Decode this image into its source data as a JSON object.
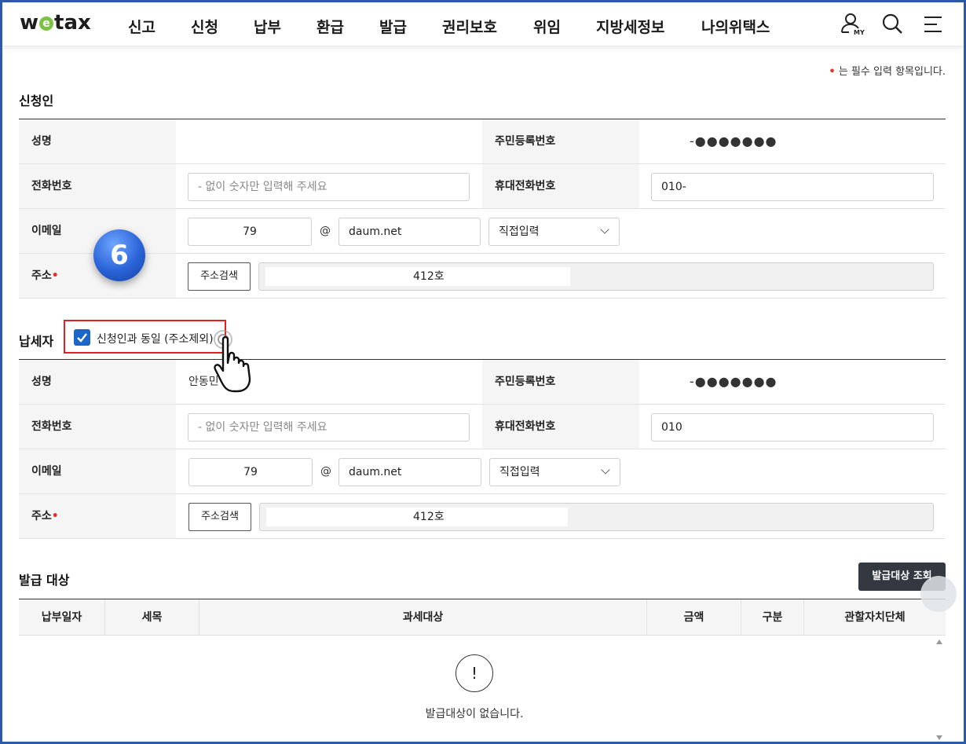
{
  "header": {
    "logo_pre": "w",
    "logo_e": "e",
    "logo_post": "tax",
    "nav": [
      "신고",
      "신청",
      "납부",
      "환급",
      "발급",
      "권리보호",
      "위임",
      "지방세정보",
      "나의위택스"
    ],
    "my_label": "MY",
    "icons": [
      "user-icon",
      "search-icon",
      "menu-icon"
    ]
  },
  "required_note": {
    "dot": "•",
    "text": " 는 필수 입력 항목입니다."
  },
  "applicant": {
    "title": "신청인",
    "name_label": "성명",
    "name_value": "",
    "rrn_label": "주민등록번호",
    "rrn_value": "-●●●●●●●",
    "phone_label": "전화번호",
    "phone_placeholder": "- 없이 숫자만 입력해 주세요",
    "mobile_label": "휴대전화번호",
    "mobile_value": "010-",
    "email_label": "이메일",
    "email_id": "79",
    "at": "@",
    "email_domain": "daum.net",
    "email_select": "직접입력",
    "address_label": "주소",
    "address_required": "•",
    "address_button": "주소검색",
    "address_value": "412호"
  },
  "step_badge": "6",
  "taxpayer": {
    "title": "납세자",
    "same_checkbox_label": "신청인과 동일 (주소제외)",
    "same_checked": true,
    "name_label": "성명",
    "name_value": "안동민",
    "rrn_label": "주민등록번호",
    "rrn_value": "-●●●●●●●",
    "phone_label": "전화번호",
    "phone_placeholder": "- 없이 숫자만 입력해 주세요",
    "mobile_label": "휴대전화번호",
    "mobile_value": "010",
    "email_label": "이메일",
    "email_id": "79",
    "at": "@",
    "email_domain": "daum.net",
    "email_select": "직접입력",
    "address_label": "주소",
    "address_required": "•",
    "address_button": "주소검색",
    "address_value": "412호"
  },
  "issue_target": {
    "title": "발급 대상",
    "query_button": "발급대상 조회",
    "columns": [
      "납부일자",
      "세목",
      "과세대상",
      "금액",
      "구분",
      "관할자치단체"
    ],
    "empty_icon": "!",
    "empty_text": "발급대상이 없습니다."
  },
  "colors": {
    "accent_blue": "#1b66c9",
    "required_red": "#e0332d",
    "highlight_red": "#e02020",
    "dark_button": "#333841",
    "logo_green": "#7cc242"
  }
}
